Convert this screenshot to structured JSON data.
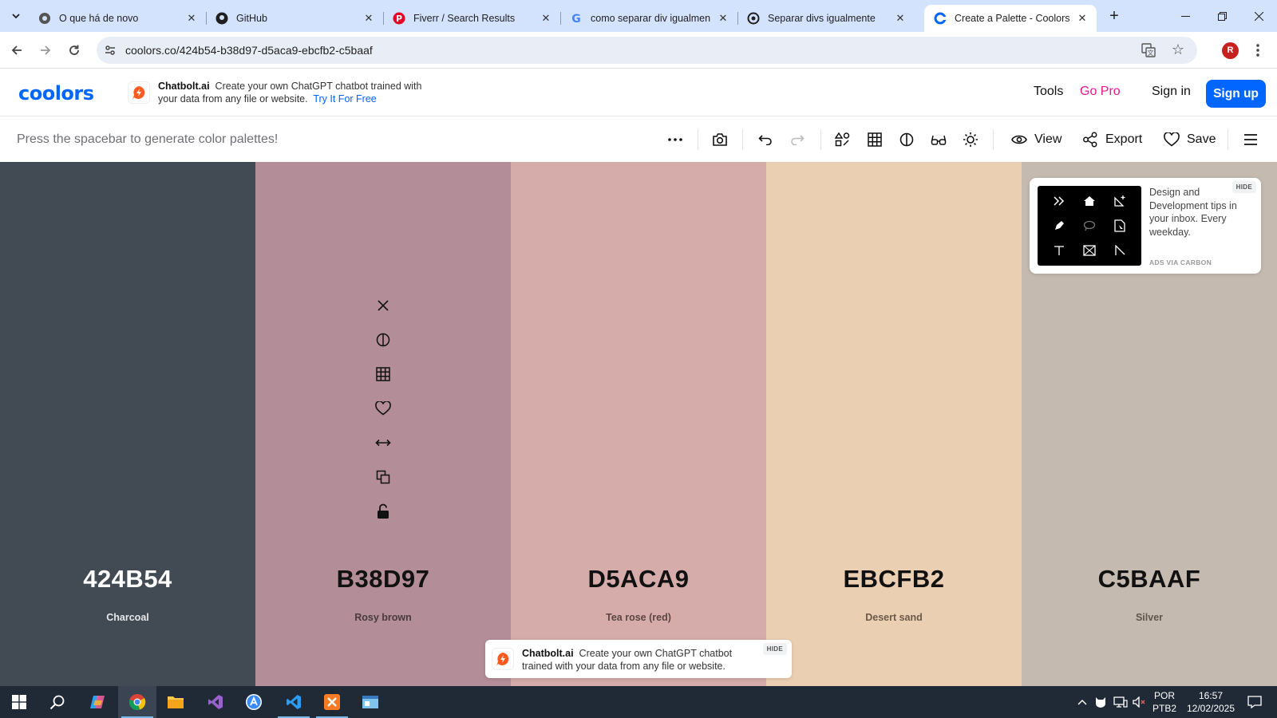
{
  "browser": {
    "tabs": [
      {
        "title": "O que há de novo",
        "icon": "chrome-icon"
      },
      {
        "title": "GitHub",
        "icon": "github-icon"
      },
      {
        "title": "Fiverr / Search Results",
        "icon": "pinterest-icon"
      },
      {
        "title": "como separar div igualmente",
        "icon": "google-icon"
      },
      {
        "title": "Separar divs igualmente",
        "icon": "openai-icon"
      },
      {
        "title": "Create a Palette - Coolors",
        "icon": "coolors-icon",
        "active": true
      }
    ],
    "new_tab_label": "+",
    "url": "coolors.co/424b54-b38d97-d5aca9-ebcfb2-c5baaf",
    "profile_initial": "R"
  },
  "header": {
    "logo": "coolors",
    "ad": {
      "brand": "Chatbolt.ai",
      "text": "Create your own ChatGPT chatbot trained with your data from any file or website.",
      "cta": "Try It For Free"
    },
    "nav": {
      "tools": "Tools",
      "go_pro": "Go Pro",
      "sign_in": "Sign in",
      "sign_up": "Sign up"
    }
  },
  "generator": {
    "hint": "Press the spacebar to generate color palettes!",
    "view_label": "View",
    "export_label": "Export",
    "save_label": "Save"
  },
  "palette": [
    {
      "hex": "424B54",
      "name": "Charcoal",
      "color": "#424b54",
      "text": "#ffffff",
      "sub": "#e6e8ea"
    },
    {
      "hex": "B38D97",
      "name": "Rosy brown",
      "color": "#b38d97",
      "text": "#111111",
      "sub": "#4a3a3f"
    },
    {
      "hex": "D5ACA9",
      "name": "Tea rose (red)",
      "color": "#d5aca9",
      "text": "#111111",
      "sub": "#5c4543"
    },
    {
      "hex": "EBCFB2",
      "name": "Desert sand",
      "color": "#ebcfb2",
      "text": "#111111",
      "sub": "#6b5a48"
    },
    {
      "hex": "C5BAAF",
      "name": "Silver",
      "color": "#c5baaf",
      "text": "#111111",
      "sub": "#5f554d"
    }
  ],
  "carbon_ad": {
    "text": "Design and Development tips in your inbox. Every weekday.",
    "via": "ADS VIA CARBON",
    "hide": "HIDE"
  },
  "bottom_ad": {
    "brand": "Chatbolt.ai",
    "text": "Create your own ChatGPT chatbot trained with your data from any file or website.",
    "hide": "HIDE"
  },
  "taskbar": {
    "lang": "POR",
    "layout": "PTB2",
    "time": "16:57",
    "date": "12/02/2025"
  },
  "colors": {
    "accent": "#0066ff",
    "gopro": "#e8168d",
    "tabstrip": "#d3e3fd",
    "taskbar": "#202a36"
  }
}
